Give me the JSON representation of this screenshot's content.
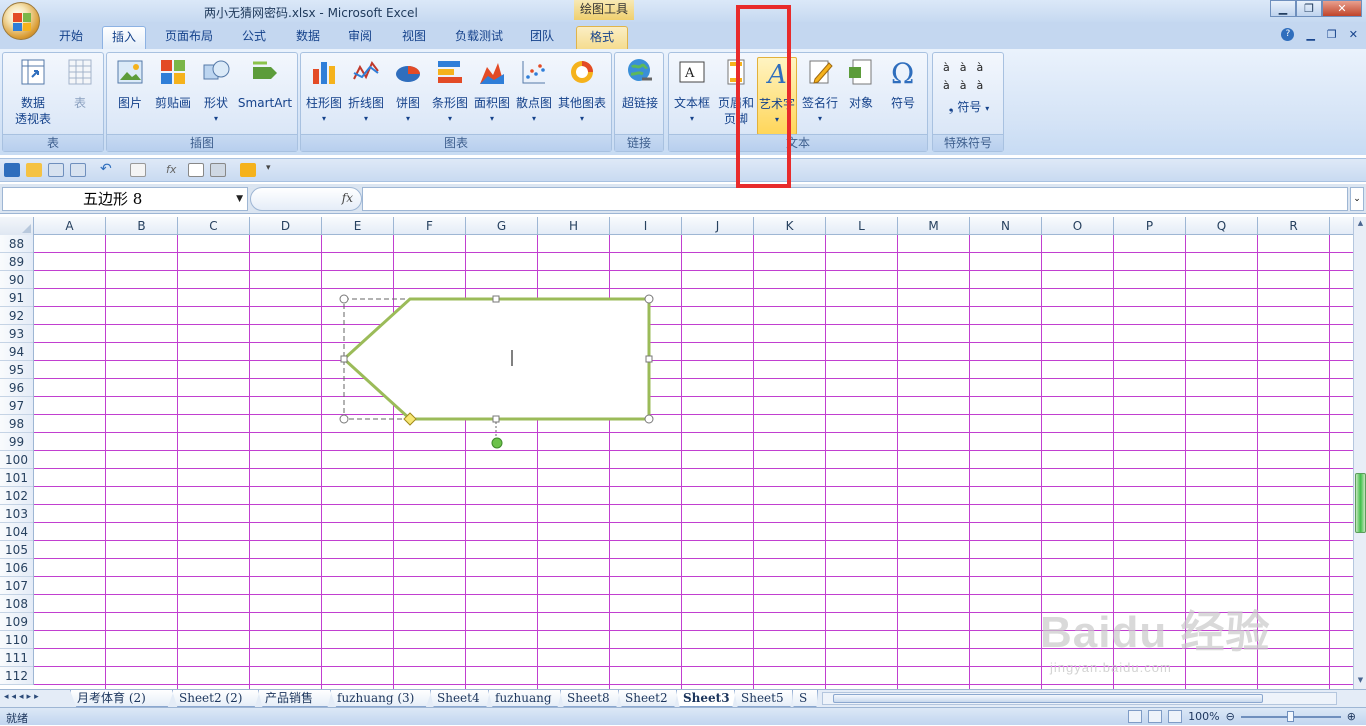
{
  "window": {
    "title": "两小无猜网密码.xlsx - Microsoft Excel",
    "context_tool": "绘图工具",
    "minimize": "▁",
    "restore": "❐",
    "close": "✕"
  },
  "tabs": [
    "开始",
    "插入",
    "页面布局",
    "公式",
    "数据",
    "审阅",
    "视图",
    "负载测试",
    "团队",
    "格式"
  ],
  "tab_active": "插入",
  "ribbon": {
    "groups": {
      "table": {
        "label": "表",
        "buttons": [
          "数据\n透视表 ▾",
          "表"
        ]
      },
      "illustrations": {
        "label": "插图",
        "buttons": [
          "图片",
          "剪贴画",
          "形状",
          "SmartArt"
        ]
      },
      "charts": {
        "label": "图表",
        "buttons": [
          "柱形图",
          "折线图",
          "饼图",
          "条形图",
          "面积图",
          "散点图",
          "其他图表"
        ]
      },
      "links": {
        "label": "链接",
        "buttons": [
          "超链接"
        ]
      },
      "text": {
        "label": "文本",
        "buttons": [
          "文本框",
          "页眉和\n页脚",
          "艺术字",
          "签名行",
          "对象",
          "符号"
        ]
      },
      "special": {
        "label": "特殊符号",
        "buttons": [
          "符号 ▾"
        ]
      }
    },
    "b_pivot": "数据",
    "b_pivot2": "透视表",
    "b_table": "表",
    "b_picture": "图片",
    "b_clipart": "剪贴画",
    "b_shape": "形状",
    "b_smartart": "SmartArt",
    "b_column": "柱形图",
    "b_line": "折线图",
    "b_pie": "饼图",
    "b_bar": "条形图",
    "b_area": "面积图",
    "b_scatter": "散点图",
    "b_other": "其他图表",
    "b_hyperlink": "超链接",
    "b_textbox": "文本框",
    "b_header": "页眉和",
    "b_header2": "页脚",
    "b_wordart": "艺术字",
    "b_signature": "签名行",
    "b_object": "对象",
    "b_symbol": "符号",
    "b_special_symbol": "符号",
    "g_table": "表",
    "g_illustrations": "插图",
    "g_charts": "图表",
    "g_links": "链接",
    "g_text": "文本",
    "g_special": "特殊符号"
  },
  "formula_bar": {
    "name_box": "五边形 8",
    "fx": "fx",
    "formula": ""
  },
  "columns": [
    "A",
    "B",
    "C",
    "D",
    "E",
    "F",
    "G",
    "H",
    "I",
    "J",
    "K",
    "L",
    "M",
    "N",
    "O",
    "P",
    "Q",
    "R"
  ],
  "rows": [
    "88",
    "89",
    "90",
    "91",
    "92",
    "93",
    "94",
    "95",
    "96",
    "97",
    "98",
    "99",
    "100",
    "101",
    "102",
    "103",
    "104",
    "105",
    "106",
    "107",
    "108",
    "109",
    "110",
    "111",
    "112"
  ],
  "sheets": [
    "月考体育 (2)",
    "Sheet2 (2)",
    "产品销售",
    "fuzhuang (3)",
    "Sheet4",
    "fuzhuang",
    "Sheet8",
    "Sheet2",
    "Sheet3",
    "Sheet5",
    "S"
  ],
  "active_sheet": "Sheet3",
  "status": {
    "ready": "就绪",
    "zoom": "100%"
  },
  "watermark": {
    "brand": "Baidu 经验",
    "url": "jingyan.baidu.com"
  },
  "colors": {
    "accent_red": "#e82b2b",
    "shape_outline": "#9bbb59",
    "gridline": "#c13fd0"
  }
}
